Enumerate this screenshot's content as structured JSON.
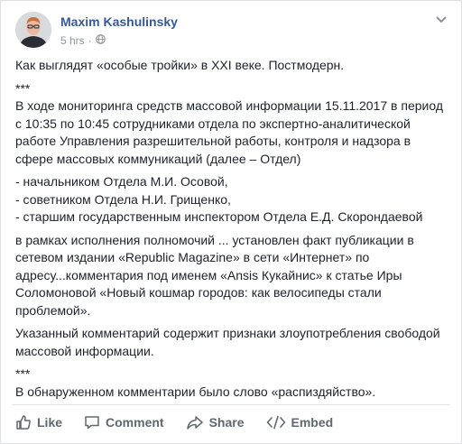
{
  "post": {
    "author_name": "Maxim Kashulinsky",
    "timestamp": "5 hrs",
    "intro": "Как выглядят «особые тройки» в XXI веке. Постмодерн.",
    "separator": "***",
    "paragraph1": "В ходе мониторинга средств массовой информации 15.11.2017 в период с 10:35 по 10:45 сотрудниками отдела по экспертно-аналитической работе Управления разрешительной работы, контроля и надзора в сфере массовых коммуникаций (далее – Отдел)",
    "list": [
      "- начальником Отдела М.И. Осовой,",
      "- советником Отдела Н.И. Грищенко,",
      "- старшим государственным инспектором Отдела Е.Д. Скорондаевой"
    ],
    "paragraph2": "в рамках исполнения полномочий ... установлен факт публикации в сетевом издании «Republic Magazine» в сети «Интернет» по адресу...комментария под именем «Ansis Кукайнис» к статье Иры Соломоновой «Новый кошмар городов: как велосипеды стали проблемой».",
    "paragraph3": "Указанный комментарий содержит признаки злоупотребления свободой массовой информации.",
    "separator2": "***",
    "paragraph4": "В обнаруженном комментарии было слово «распиздяйство»."
  },
  "actions": {
    "like": "Like",
    "comment": "Comment",
    "share": "Share",
    "embed": "Embed"
  },
  "icons": {
    "privacy": "globe-icon",
    "menu": "chevron-down-icon",
    "like": "thumbs-up-icon",
    "comment": "comment-bubble-icon",
    "share": "share-arrow-icon",
    "embed": "code-icon"
  },
  "colors": {
    "author": "#365899",
    "meta": "#90949c",
    "text": "#1d2129",
    "action": "#606770"
  }
}
